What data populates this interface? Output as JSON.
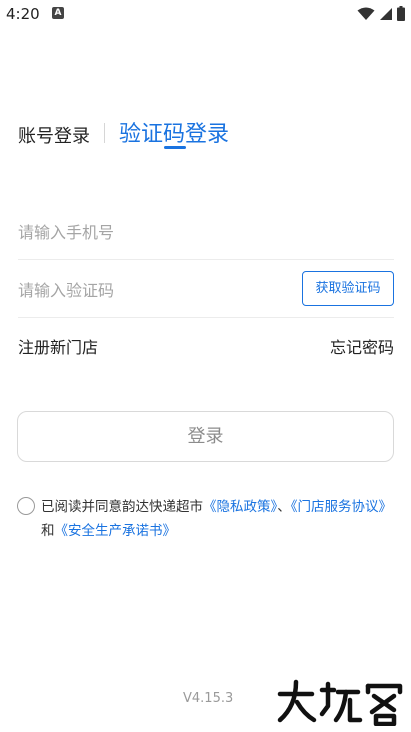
{
  "status_bar": {
    "time": "4:20",
    "notification_badge": "A",
    "icons": [
      "wifi-icon",
      "signal-icon",
      "battery-icon"
    ]
  },
  "tabs": {
    "account_login": "账号登录",
    "verify_login": "验证码登录",
    "active": "verify_login"
  },
  "form": {
    "phone_placeholder": "请输入手机号",
    "code_placeholder": "请输入验证码",
    "get_code_label": "获取验证码",
    "phone_value": "",
    "code_value": ""
  },
  "links": {
    "register": "注册新门店",
    "forgot_password": "忘记密码"
  },
  "login_button": "登录",
  "agreement": {
    "checked": false,
    "prefix": "已阅读并同意韵达快递超市",
    "privacy_policy": "《隐私政策》",
    "separator": "、",
    "store_service": "《门店服务协议》",
    "and": "和",
    "safety_commitment": "《安全生产承诺书》"
  },
  "version": "V4.15.3",
  "colors": {
    "accent": "#1a73e0",
    "text": "#222222",
    "placeholder": "#a5a5a5",
    "disabled_text": "#8c8c8c"
  }
}
